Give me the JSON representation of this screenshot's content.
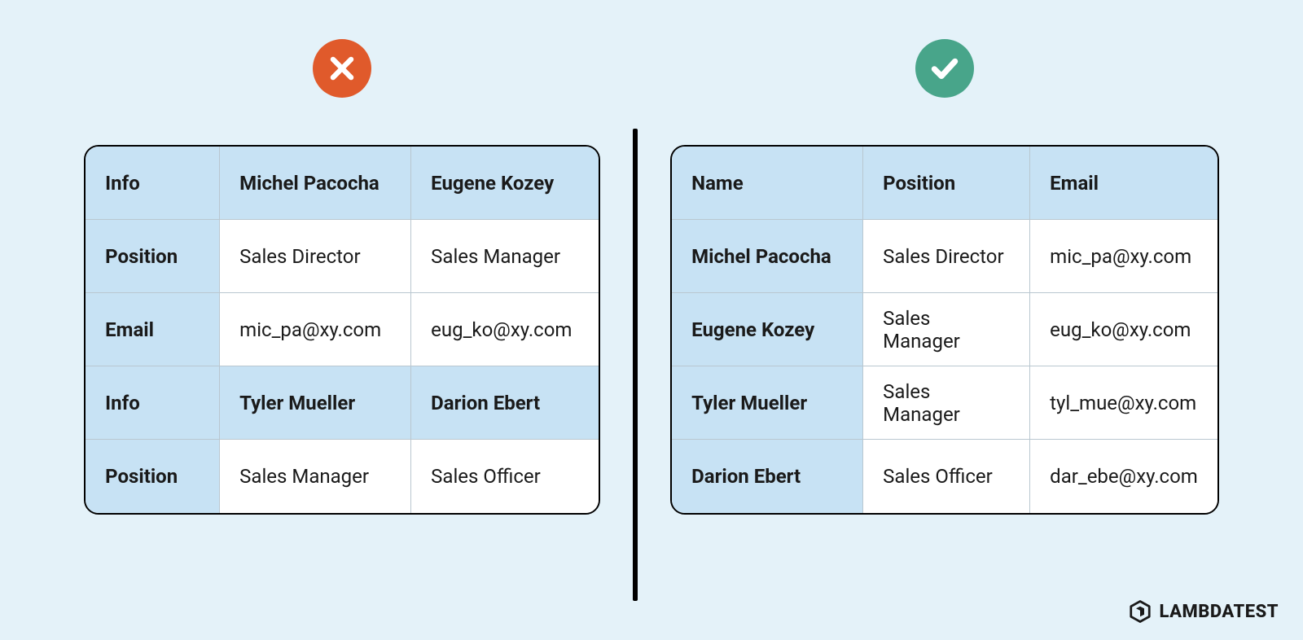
{
  "brand": "LAMBDATEST",
  "left_table": {
    "rows": [
      {
        "label": "Info",
        "c1": "Michel Pacocha",
        "c2": "Eugene Kozey",
        "style": "header"
      },
      {
        "label": "Position",
        "c1": "Sales Director",
        "c2": "Sales Manager",
        "style": "data"
      },
      {
        "label": "Email",
        "c1": "mic_pa@xy.com",
        "c2": "eug_ko@xy.com",
        "style": "data"
      },
      {
        "label": "Info",
        "c1": "Tyler Mueller",
        "c2": "Darion Ebert",
        "style": "header"
      },
      {
        "label": "Position",
        "c1": "Sales Manager",
        "c2": "Sales Officer",
        "style": "data"
      }
    ]
  },
  "right_table": {
    "headers": [
      "Name",
      "Position",
      "Email"
    ],
    "rows": [
      {
        "name": "Michel Pacocha",
        "position": "Sales Director",
        "email": "mic_pa@xy.com"
      },
      {
        "name": "Eugene Kozey",
        "position": "Sales Manager",
        "email": "eug_ko@xy.com"
      },
      {
        "name": "Tyler Mueller",
        "position": "Sales Manager",
        "email": "tyl_mue@xy.com"
      },
      {
        "name": "Darion Ebert",
        "position": "Sales Officer",
        "email": "dar_ebe@xy.com"
      }
    ]
  }
}
